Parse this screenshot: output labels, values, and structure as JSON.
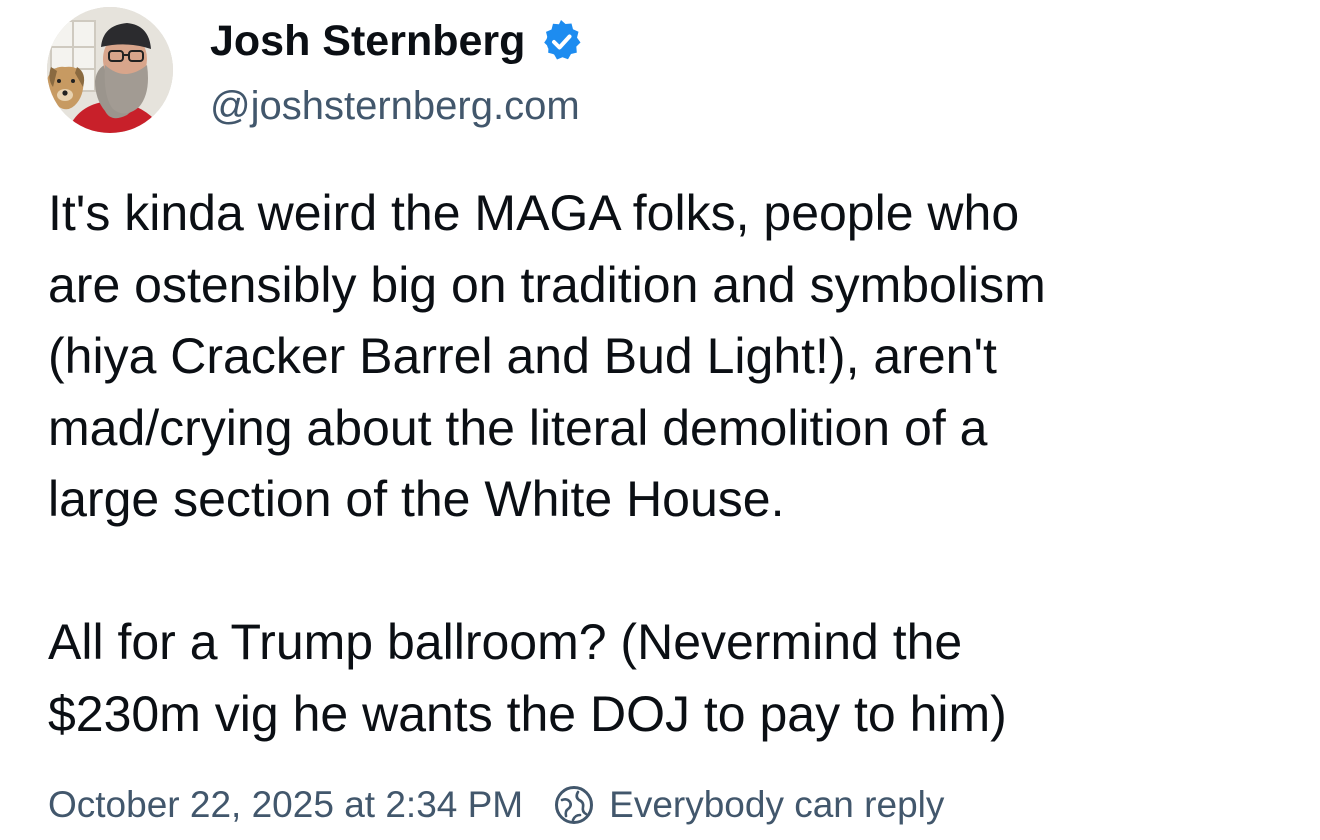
{
  "author": {
    "display_name": "Josh Sternberg",
    "handle": "@joshsternberg.com",
    "verified": true,
    "avatar_icon": "avatar-icon",
    "verified_icon": "verified-badge-icon",
    "verified_color": "#1d8cf0"
  },
  "post": {
    "paragraphs": [
      "It's kinda weird the MAGA folks, people who\nare ostensibly big on tradition and symbolism\n(hiya Cracker Barrel and Bud Light!), aren't\nmad/crying about the literal demolition of a\nlarge section of the White House.",
      "All for a Trump ballroom? (Nevermind the\n$230m vig he wants the DOJ to pay to him)"
    ]
  },
  "meta": {
    "timestamp": "October 22, 2025 at 2:34 PM",
    "reply_setting": "Everybody can reply",
    "reply_icon": "globe-icon"
  },
  "colors": {
    "text_primary": "#0b0f14",
    "text_secondary": "#42576c",
    "background": "#ffffff"
  }
}
